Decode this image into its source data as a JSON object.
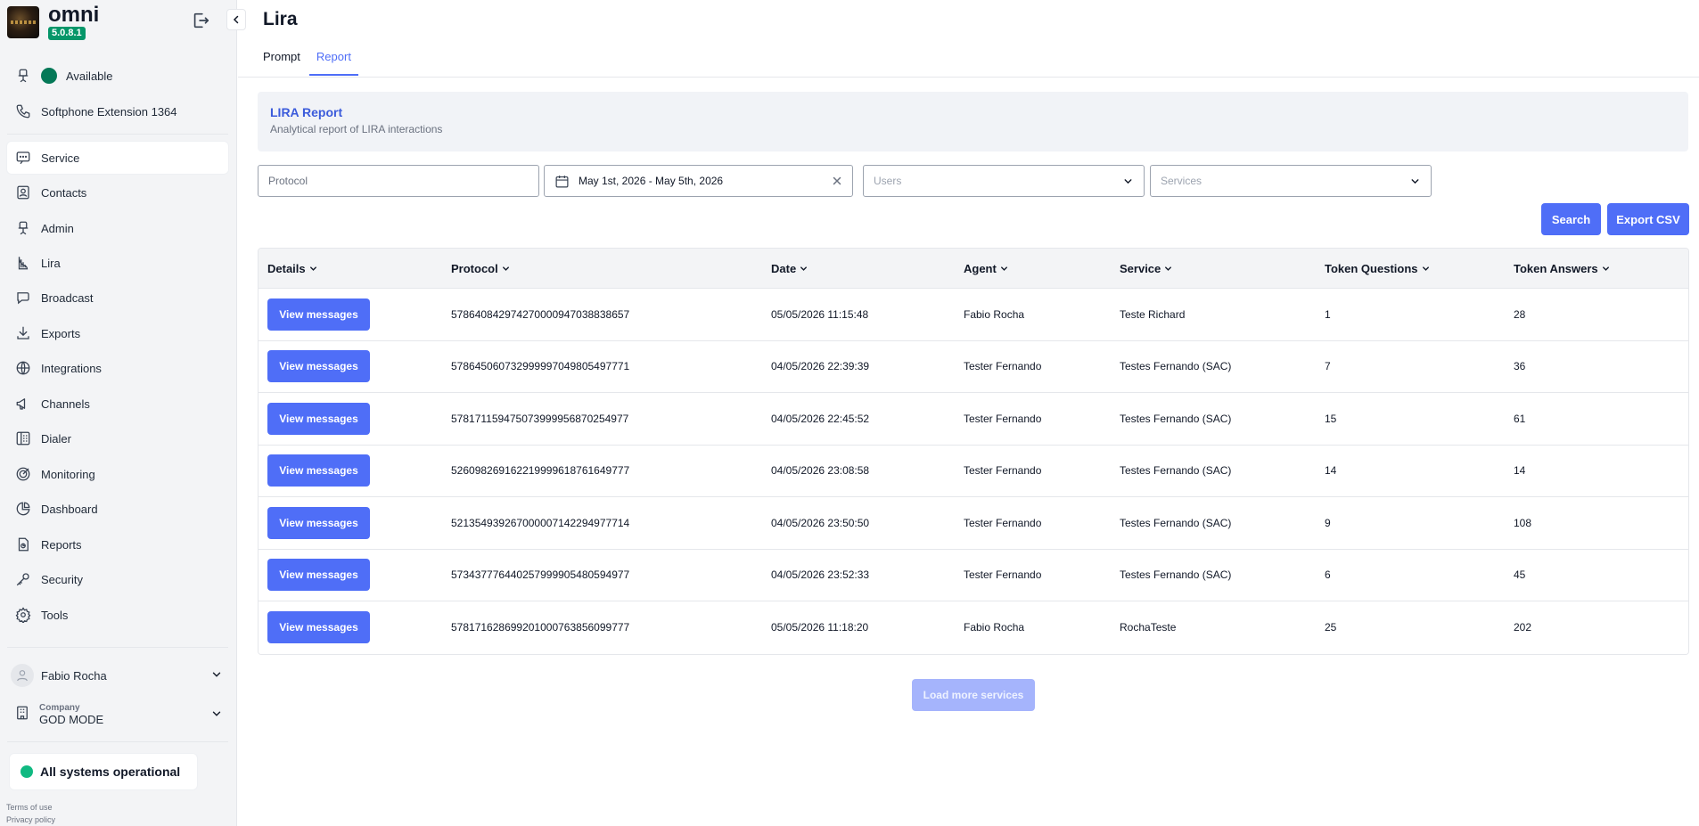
{
  "app": {
    "name": "omni",
    "version": "5.0.8.1"
  },
  "sidebar": {
    "status": "Available",
    "softphone": "Softphone Extension 1364",
    "items": [
      {
        "label": "Service",
        "icon": "chat-icon"
      },
      {
        "label": "Contacts",
        "icon": "contacts-icon"
      },
      {
        "label": "Admin",
        "icon": "admin-chair-icon"
      },
      {
        "label": "Lira",
        "icon": "lira-harp-icon"
      },
      {
        "label": "Broadcast",
        "icon": "broadcast-icon"
      },
      {
        "label": "Exports",
        "icon": "download-icon"
      },
      {
        "label": "Integrations",
        "icon": "globe-icon"
      },
      {
        "label": "Channels",
        "icon": "megaphone-icon"
      },
      {
        "label": "Dialer",
        "icon": "dialer-icon"
      },
      {
        "label": "Monitoring",
        "icon": "target-icon"
      },
      {
        "label": "Dashboard",
        "icon": "pie-chart-icon"
      },
      {
        "label": "Reports",
        "icon": "report-icon"
      },
      {
        "label": "Security",
        "icon": "key-icon"
      },
      {
        "label": "Tools",
        "icon": "gear-icon"
      }
    ],
    "user": "Fabio Rocha",
    "company_label": "Company",
    "company_name": "GOD MODE",
    "systems_status": "All systems operational",
    "terms": "Terms of use",
    "privacy": "Privacy policy"
  },
  "page": {
    "title": "Lira",
    "tabs": [
      "Prompt",
      "Report"
    ],
    "active_tab": "Report"
  },
  "banner": {
    "title": "LIRA Report",
    "subtitle": "Analytical report of LIRA interactions"
  },
  "filters": {
    "protocol_placeholder": "Protocol",
    "date_range": "May 1st, 2026 - May 5th, 2026",
    "users_placeholder": "Users",
    "services_placeholder": "Services"
  },
  "actions": {
    "search": "Search",
    "export": "Export CSV"
  },
  "table": {
    "headers": [
      "Details",
      "Protocol",
      "Date",
      "Agent",
      "Service",
      "Token Questions",
      "Token Answers"
    ],
    "button_label": "View messages",
    "rows": [
      {
        "protocol": "578640842974270000947038838657",
        "date": "05/05/2026 11:15:48",
        "agent": "Fabio Rocha",
        "service": "Teste Richard",
        "questions": "1",
        "answers": "28"
      },
      {
        "protocol": "578645060732999997049805497771",
        "date": "04/05/2026 22:39:39",
        "agent": "Tester Fernando",
        "service": "Testes Fernando (SAC)",
        "questions": "7",
        "answers": "36"
      },
      {
        "protocol": "578171159475073999956870254977",
        "date": "04/05/2026 22:45:52",
        "agent": "Tester Fernando",
        "service": "Testes Fernando (SAC)",
        "questions": "15",
        "answers": "61"
      },
      {
        "protocol": "526098269162219999618761649777",
        "date": "04/05/2026 23:08:58",
        "agent": "Tester Fernando",
        "service": "Testes Fernando (SAC)",
        "questions": "14",
        "answers": "14"
      },
      {
        "protocol": "521354939267000007142294977714",
        "date": "04/05/2026 23:50:50",
        "agent": "Tester Fernando",
        "service": "Testes Fernando (SAC)",
        "questions": "9",
        "answers": "108"
      },
      {
        "protocol": "573437776440257999905480594977",
        "date": "04/05/2026 23:52:33",
        "agent": "Tester Fernando",
        "service": "Testes Fernando (SAC)",
        "questions": "6",
        "answers": "45"
      },
      {
        "protocol": "578171628699201000763856099777",
        "date": "05/05/2026 11:18:20",
        "agent": "Fabio Rocha",
        "service": "RochaTeste",
        "questions": "25",
        "answers": "202"
      }
    ]
  },
  "load_more": "Load more services"
}
